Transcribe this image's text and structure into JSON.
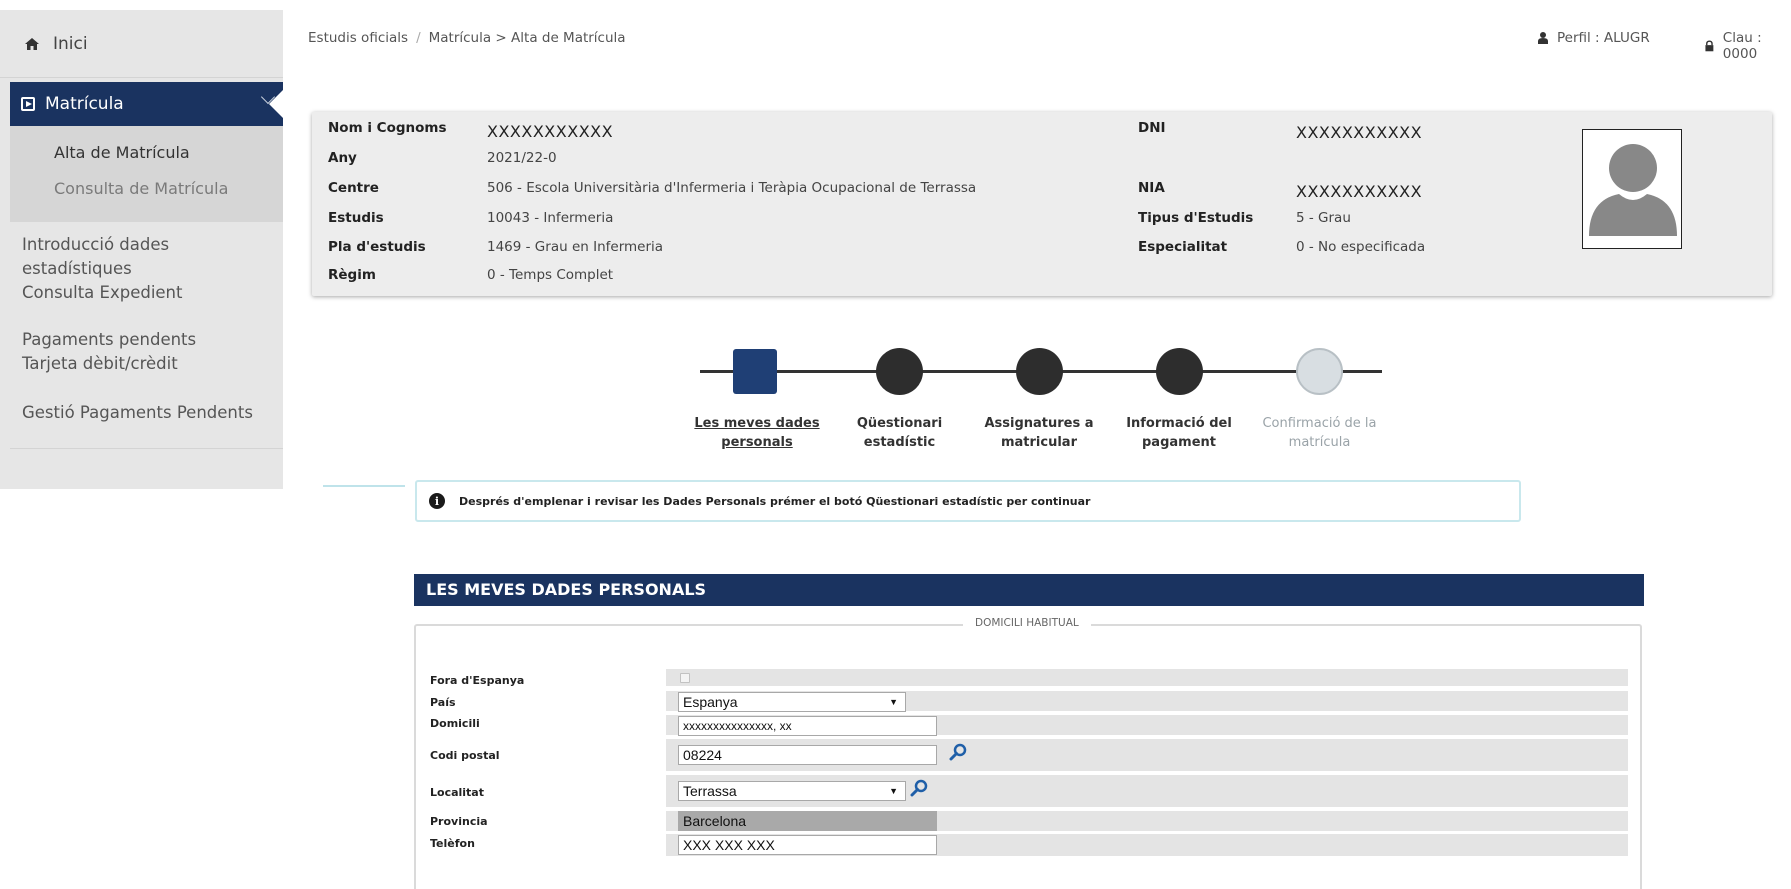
{
  "sidebar": {
    "home_label": "Inici",
    "matricula_label": "Matrícula",
    "sub_items": [
      "Alta de Matrícula",
      "Consulta de Matrícula"
    ],
    "items": [
      "Introducció dades estadístiques",
      "Consulta Expedient",
      "Pagaments pendents Tarjeta dèbit/crèdit",
      "Gestió Pagaments Pendents"
    ]
  },
  "breadcrumb": {
    "root": "Estudis oficials",
    "path": "Matrícula > Alta de Matrícula"
  },
  "topbar": {
    "profile": "Perfil : ALUGR",
    "key": "Clau : 0000"
  },
  "student": {
    "name_label": "Nom i Cognoms",
    "name": "XXXXXXXXXXX",
    "year_label": "Any",
    "year": "2021/22-0",
    "centre_label": "Centre",
    "centre": "506 - Escola Universitària d'Infermeria i Teràpia Ocupacional de Terrassa",
    "studies_label": "Estudis",
    "studies": "10043 - Infermeria",
    "plan_label": "Pla d'estudis",
    "plan": "1469 - Grau en Infermeria",
    "regime_label": "Règim",
    "regime": "0 - Temps Complet",
    "dni_label": "DNI",
    "dni": "XXXXXXXXXXX",
    "nia_label": "NIA",
    "nia": "XXXXXXXXXXX",
    "type_label": "Tipus d'Estudis",
    "type": "5 - Grau",
    "spec_label": "Especialitat",
    "spec": "0 - No especificada"
  },
  "steps": [
    {
      "label": "Les meves dades personals",
      "state": "current"
    },
    {
      "label": "Qüestionari estadístic",
      "state": "pending"
    },
    {
      "label": "Assignatures a matricular",
      "state": "pending"
    },
    {
      "label": "Informació del pagament",
      "state": "pending"
    },
    {
      "label": "Confirmació de la matrícula",
      "state": "disabled"
    }
  ],
  "alert": {
    "text": "Després d'emplenar i revisar les Dades Personals prémer el botó Qüestionari estadístic per continuar"
  },
  "section": {
    "title": "LES MEVES DADES PERSONALS",
    "legend": "DOMICILI HABITUAL"
  },
  "form": {
    "fora_label": "Fora d'Espanya",
    "fora_checked": false,
    "pais_label": "País",
    "pais_value": "Espanya",
    "domicili_label": "Domicili",
    "domicili_value": "xxxxxxxxxxxxxxx, xx",
    "codi_label": "Codi postal",
    "codi_value": "08224",
    "localitat_label": "Localitat",
    "localitat_value": "Terrassa",
    "provincia_label": "Provincia",
    "provincia_value": "Barcelona",
    "telefon_label": "Telèfon",
    "telefon_value": "XXX XXX XXX"
  },
  "colors": {
    "navy": "#1a3360",
    "sidebar_bg": "#e6e6e6",
    "search_icon": "#1f5fa8"
  }
}
